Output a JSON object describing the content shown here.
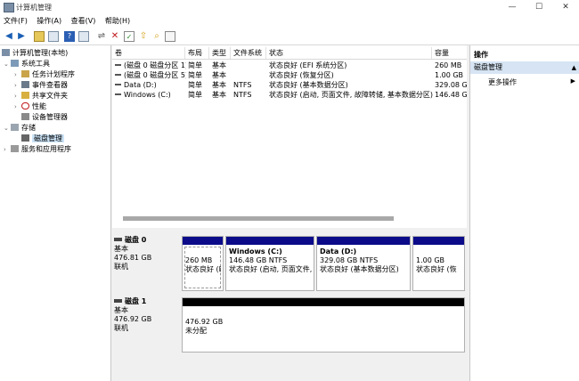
{
  "window": {
    "title": "计算机管理",
    "minimize": "—",
    "maximize": "☐",
    "close": "✕"
  },
  "menu": [
    "文件(F)",
    "操作(A)",
    "查看(V)",
    "帮助(H)"
  ],
  "tree": {
    "root": "计算机管理(本地)",
    "system_tools": "系统工具",
    "task_scheduler": "任务计划程序",
    "event_viewer": "事件查看器",
    "shared_folders": "共享文件夹",
    "performance": "性能",
    "device_manager": "设备管理器",
    "storage": "存储",
    "disk_management": "磁盘管理",
    "services": "服务和应用程序"
  },
  "columns": [
    "卷",
    "布局",
    "类型",
    "文件系统",
    "状态",
    "容量"
  ],
  "volumes": [
    {
      "name": "(磁盘 0 磁盘分区 1)",
      "layout": "简单",
      "type": "基本",
      "fs": "",
      "status": "状态良好 (EFI 系统分区)",
      "capacity": "260 MB"
    },
    {
      "name": "(磁盘 0 磁盘分区 5)",
      "layout": "简单",
      "type": "基本",
      "fs": "",
      "status": "状态良好 (恢复分区)",
      "capacity": "1.00 GB"
    },
    {
      "name": "Data (D:)",
      "layout": "简单",
      "type": "基本",
      "fs": "NTFS",
      "status": "状态良好 (基本数据分区)",
      "capacity": "329.08 G"
    },
    {
      "name": "Windows (C:)",
      "layout": "简单",
      "type": "基本",
      "fs": "NTFS",
      "status": "状态良好 (启动, 页面文件, 故障转储, 基本数据分区)",
      "capacity": "146.48 G"
    }
  ],
  "disks": [
    {
      "name": "磁盘 0",
      "type": "基本",
      "size": "476.81 GB",
      "status": "联机",
      "partitions": [
        {
          "name": "",
          "size": "260 MB",
          "status": "状态良好 (E"
        },
        {
          "name": "Windows  (C:)",
          "size": "146.48 GB NTFS",
          "status": "状态良好 (启动, 页面文件,"
        },
        {
          "name": "Data  (D:)",
          "size": "329.08 GB NTFS",
          "status": "状态良好 (基本数据分区)"
        },
        {
          "name": "",
          "size": "1.00 GB",
          "status": "状态良好 (恢"
        }
      ]
    },
    {
      "name": "磁盘 1",
      "type": "基本",
      "size": "476.92 GB",
      "status": "联机",
      "partitions": [
        {
          "size": "476.92 GB",
          "status": "未分配"
        }
      ]
    }
  ],
  "actions": {
    "title": "操作",
    "section": "磁盘管理",
    "more": "更多操作"
  }
}
